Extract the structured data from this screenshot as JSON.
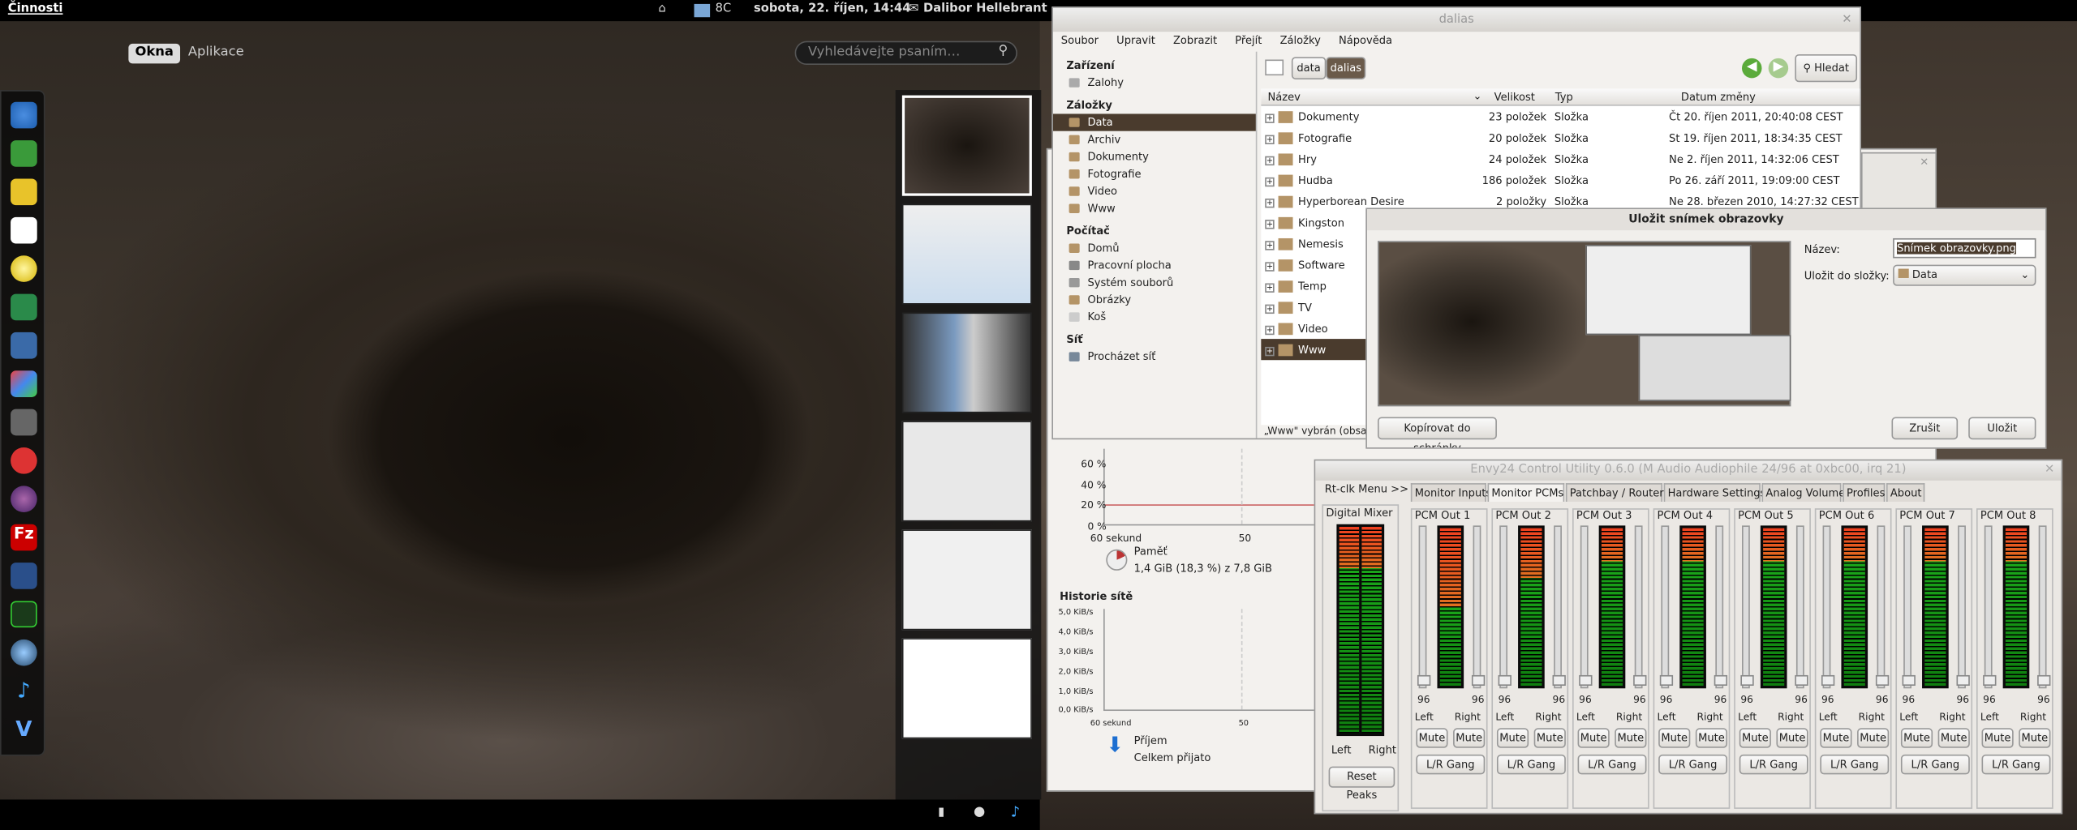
{
  "topbar": {
    "activities": "Činnosti",
    "weather": "8C",
    "clock": "sobota, 22. říjen, 14:44",
    "user": "Dalibor Hellebrant"
  },
  "overview": {
    "tab_windows": "Okna",
    "tab_apps": "Aplikace",
    "search_placeholder": "Vyhledávejte psaním…"
  },
  "dash": {
    "icons": [
      "chromium-icon",
      "photo-icon",
      "notes-icon",
      "text-editor-icon",
      "cd-icon",
      "tools-icon",
      "terminal-icon",
      "palette-icon",
      "camera-icon",
      "dc-icon",
      "disc-icon",
      "filezilla-icon",
      "graph-icon",
      "system-monitor-icon",
      "globe-icon",
      "music-icon",
      "vim-icon"
    ]
  },
  "files": {
    "title": "dalias",
    "menu": [
      "Soubor",
      "Upravit",
      "Zobrazit",
      "Přejít",
      "Záložky",
      "Nápověda"
    ],
    "path": [
      "data",
      "dalias"
    ],
    "search_label": "Hledat",
    "sidebar": {
      "h_devices": "Zařízení",
      "devices": [
        "Zalohy"
      ],
      "h_bookmarks": "Záložky",
      "bookmarks": [
        "Data",
        "Archiv",
        "Dokumenty",
        "Fotografie",
        "Video",
        "Www"
      ],
      "h_computer": "Počítač",
      "computer": [
        "Domů",
        "Pracovní plocha",
        "Systém souborů",
        "Obrázky",
        "Koš"
      ],
      "h_net": "Síť",
      "net": [
        "Procházet síť"
      ]
    },
    "columns": [
      "Název",
      "Velikost",
      "Typ",
      "Datum změny"
    ],
    "rows": [
      [
        "Dokumenty",
        "23 položek",
        "Složka",
        "Čt 20. říjen 2011, 20:40:08 CEST"
      ],
      [
        "Fotografie",
        "20 položek",
        "Složka",
        "St 19. říjen 2011, 18:34:35 CEST"
      ],
      [
        "Hry",
        "24 položek",
        "Složka",
        "Ne 2. říjen 2011, 14:32:06 CEST"
      ],
      [
        "Hudba",
        "186 položek",
        "Složka",
        "Po 26. září 2011, 19:09:00 CEST"
      ],
      [
        "Hyperborean Desire",
        "2 položky",
        "Složka",
        "Ne 28. březen 2010, 14:27:32 CEST"
      ],
      [
        "Kingston",
        "",
        "",
        ""
      ],
      [
        "Nemesis",
        "",
        "",
        ""
      ],
      [
        "Software",
        "",
        "",
        ""
      ],
      [
        "Temp",
        "",
        "",
        ""
      ],
      [
        "TV",
        "",
        "",
        ""
      ],
      [
        "Video",
        "",
        "",
        ""
      ],
      [
        "Www",
        "",
        "",
        ""
      ]
    ],
    "status": "„Www\" vybrán (obsah"
  },
  "dialog": {
    "title": "Uložit snímek obrazovky",
    "name_label": "Název:",
    "name_value": "Snímek obrazovky.png",
    "folder_label": "Uložit do složky:",
    "folder_value": "Data",
    "copy": "Kopírovat do schránky",
    "cancel": "Zrušit",
    "save": "Uložit"
  },
  "monitor": {
    "ticks": [
      "60 %",
      "40 %",
      "20 %",
      "0 %"
    ],
    "x_ticks": [
      "60 sekund",
      "50"
    ],
    "mem_label": "Paměť",
    "mem_value": "1,4 GiB (18,3 %) z 7,8 GiB",
    "net_title": "Historie sítě",
    "net_ticks": [
      "5,0 KiB/s",
      "4,0 KiB/s",
      "3,0 KiB/s",
      "2,0 KiB/s",
      "1,0 KiB/s",
      "0,0 KiB/s"
    ],
    "recv": "Příjem",
    "recv_total": "Celkem přijato"
  },
  "mixer": {
    "title": "Envy24 Control Utility 0.6.0 (M Audio Audiophile 24/96 at 0xbc00, irq 21)",
    "rtclk": "Rt-clk Menu >>",
    "tabs": [
      "Monitor Inputs",
      "Monitor PCMs",
      "Patchbay / Router",
      "Hardware Settings",
      "Analog Volume",
      "Profiles",
      "About"
    ],
    "digital": "Digital Mixer",
    "left": "Left",
    "right": "Right",
    "reset": "Reset Peaks",
    "channels": [
      "PCM Out 1",
      "PCM Out 2",
      "PCM Out 3",
      "PCM Out 4",
      "PCM Out 5",
      "PCM Out 6",
      "PCM Out 7",
      "PCM Out 8"
    ],
    "vol": "96",
    "mute": "Mute",
    "gang": "L/R Gang"
  }
}
